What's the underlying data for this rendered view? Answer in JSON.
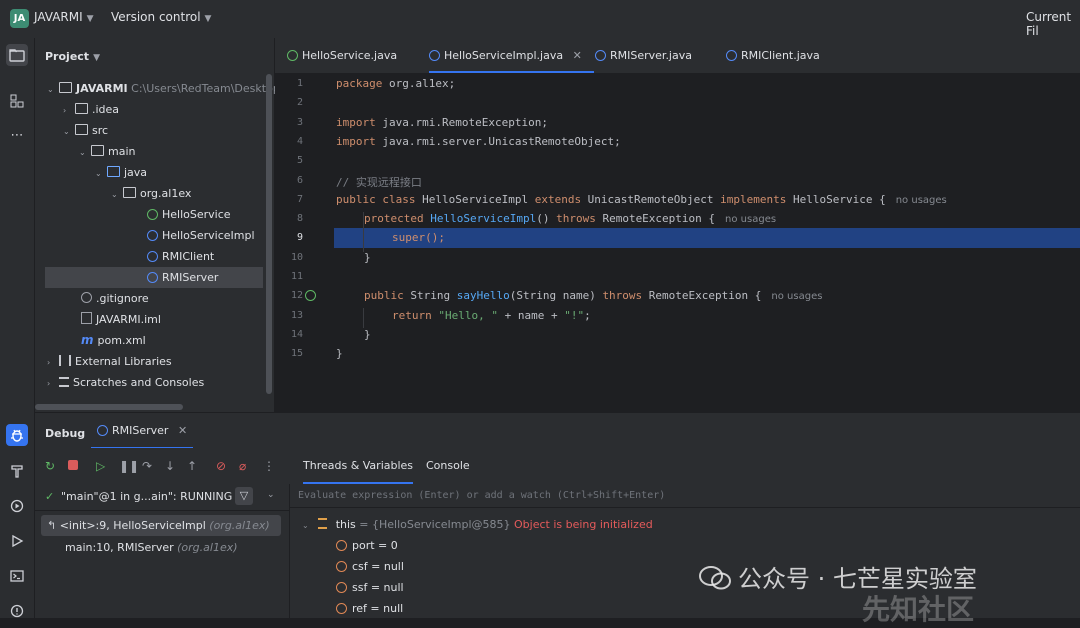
{
  "titlebar": {
    "project_badge": "JA",
    "project_name": "JAVARMI",
    "vcs_label": "Version control",
    "right_label": "Current Fil"
  },
  "project_panel": {
    "title": "Project",
    "tree": [
      {
        "label": "JAVARMI",
        "path": "C:\\Users\\RedTeam\\Desktop"
      },
      {
        "label": ".idea"
      },
      {
        "label": "src"
      },
      {
        "label": "main"
      },
      {
        "label": "java"
      },
      {
        "label": "org.al1ex"
      },
      {
        "label": "HelloService"
      },
      {
        "label": "HelloServiceImpl"
      },
      {
        "label": "RMIClient"
      },
      {
        "label": "RMIServer"
      },
      {
        "label": ".gitignore"
      },
      {
        "label": "JAVARMI.iml"
      },
      {
        "label": "pom.xml"
      },
      {
        "label": "External Libraries"
      },
      {
        "label": "Scratches and Consoles"
      }
    ]
  },
  "tabs": [
    {
      "label": "HelloService.java"
    },
    {
      "label": "HelloServiceImpl.java"
    },
    {
      "label": "RMIServer.java"
    },
    {
      "label": "RMIClient.java"
    }
  ],
  "editor": {
    "line_numbers": [
      "1",
      "2",
      "3",
      "4",
      "5",
      "6",
      "7",
      "8",
      "9",
      "10",
      "11",
      "12",
      "13",
      "14",
      "15"
    ],
    "lines": {
      "l1_kw": "package",
      "l1_rest": " org.al1ex;",
      "l3_kw": "import",
      "l3_rest": " java.rmi.RemoteException;",
      "l4_kw": "import",
      "l4_rest": " java.rmi.server.UnicastRemoteObject;",
      "l6": "// 实现远程接口",
      "l7_a": "public class",
      "l7_b": " HelloServiceImpl ",
      "l7_c": "extends",
      "l7_d": " UnicastRemoteObject ",
      "l7_e": "implements",
      "l7_f": " HelloService {",
      "l8_a": "protected",
      "l8_b": "HelloServiceImpl",
      "l8_c": "() ",
      "l8_d": "throws",
      "l8_e": " RemoteException {",
      "l9": "super();",
      "l10": "}",
      "l12_a": "public",
      "l12_b": " String ",
      "l12_c": "sayHello",
      "l12_d": "(String name) ",
      "l12_e": "throws",
      "l12_f": " RemoteException {",
      "l13_a": "return",
      "l13_b": "\"Hello, \"",
      "l13_c": " + name + ",
      "l13_d": "\"!\"",
      "l13_e": ";",
      "l14": "}",
      "l15": "}"
    },
    "hint": "no usages"
  },
  "debug": {
    "title": "Debug",
    "config_tab": "RMIServer",
    "tabs": [
      "Threads & Variables",
      "Console"
    ],
    "thread_label": "\"main\"@1 in g...ain\": RUNNING",
    "eval_placeholder": "Evaluate expression (Enter) or add a watch (Ctrl+Shift+Enter)",
    "frames": [
      {
        "method": "<init>:9, HelloServiceImpl",
        "pkg": "(org.al1ex)"
      },
      {
        "method": "main:10, RMIServer",
        "pkg": "(org.al1ex)"
      }
    ],
    "vars": {
      "this_name": "this",
      "this_value": " = {HelloServiceImpl@585} ",
      "this_status": "Object is being initialized",
      "fields": [
        {
          "name": "port",
          "value": " = 0"
        },
        {
          "name": "csf",
          "value": " = null"
        },
        {
          "name": "ssf",
          "value": " = null"
        },
        {
          "name": "ref",
          "value": " = null"
        }
      ]
    }
  },
  "watermark": {
    "text": "公众号 · 七芒星实验室",
    "text2": "先知社区"
  }
}
